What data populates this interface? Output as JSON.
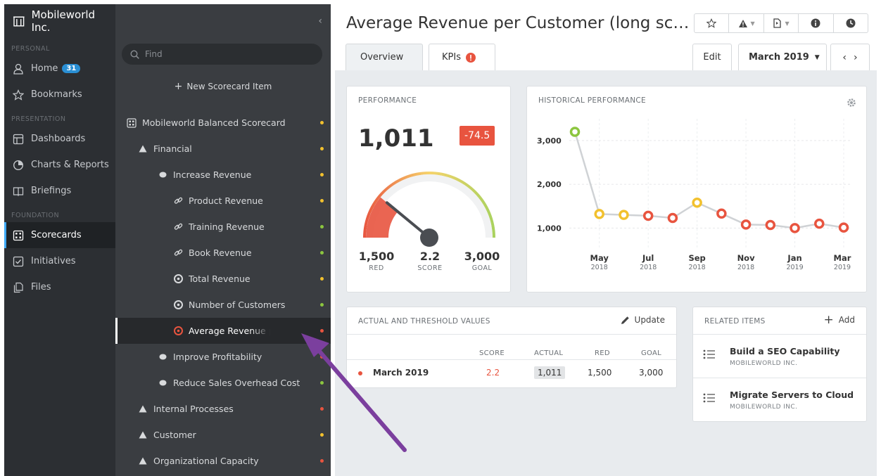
{
  "nav": {
    "brand": "Mobileworld Inc.",
    "sections": {
      "personal": "PERSONAL",
      "presentation": "PRESENTATION",
      "foundation": "FOUNDATION"
    },
    "items": {
      "home": "Home",
      "home_badge": "31",
      "bookmarks": "Bookmarks",
      "dashboards": "Dashboards",
      "charts": "Charts & Reports",
      "briefings": "Briefings",
      "scorecards": "Scorecards",
      "initiatives": "Initiatives",
      "files": "Files"
    }
  },
  "tree": {
    "find_placeholder": "Find",
    "new_item": "New Scorecard Item",
    "rows": [
      {
        "label": "Mobileworld Balanced Scorecard",
        "icon": "scorecard-icon",
        "status": "#f2c12e"
      },
      {
        "label": "Financial",
        "icon": "triangle-icon",
        "status": "#f2c12e"
      },
      {
        "label": "Increase Revenue",
        "icon": "ellipse-icon",
        "status": "#f2c12e"
      },
      {
        "label": "Product Revenue",
        "icon": "link-icon",
        "status": "#f2c12e"
      },
      {
        "label": "Training Revenue",
        "icon": "link-icon",
        "status": "#8cc63f"
      },
      {
        "label": "Book Revenue",
        "icon": "link-icon",
        "status": "#8cc63f"
      },
      {
        "label": "Total Revenue",
        "icon": "kpi-icon",
        "status": "#f2c12e"
      },
      {
        "label": "Number of Customers",
        "icon": "kpi-icon",
        "status": "#8cc63f"
      },
      {
        "label": "Average Revenue per Cu",
        "icon": "kpi-icon",
        "status": "#e8543f"
      },
      {
        "label": "Improve Profitability",
        "icon": "ellipse-icon",
        "status": "#e8543f"
      },
      {
        "label": "Reduce Sales Overhead Cost",
        "icon": "ellipse-icon",
        "status": "#8cc63f"
      },
      {
        "label": "Internal Processes",
        "icon": "triangle-icon",
        "status": "#e8543f"
      },
      {
        "label": "Customer",
        "icon": "triangle-icon",
        "status": "#f2c12e"
      },
      {
        "label": "Organizational Capacity",
        "icon": "triangle-icon",
        "status": "#e8543f"
      }
    ]
  },
  "header": {
    "title": "Average Revenue per Customer (long sc…",
    "tabs": {
      "overview": "Overview",
      "kpis": "KPIs",
      "edit": "Edit"
    },
    "period": "March 2019"
  },
  "performance": {
    "title": "PERFORMANCE",
    "actual": "1,011",
    "delta": "-74.5",
    "red_value": "1,500",
    "red_label": "RED",
    "score_value": "2.2",
    "score_label": "SCORE",
    "goal_value": "3,000",
    "goal_label": "GOAL",
    "gauge_score": 2.2,
    "gauge_max": 10
  },
  "history": {
    "title": "HISTORICAL PERFORMANCE"
  },
  "chart_data": {
    "type": "line",
    "title": "HISTORICAL PERFORMANCE",
    "x": [
      "Apr 2018",
      "May 2018",
      "Jun 2018",
      "Jul 2018",
      "Aug 2018",
      "Sep 2018",
      "Oct 2018",
      "Nov 2018",
      "Dec 2018",
      "Jan 2019",
      "Feb 2019",
      "Mar 2019"
    ],
    "values": [
      3200,
      1320,
      1300,
      1280,
      1230,
      1580,
      1330,
      1080,
      1070,
      1000,
      1100,
      1011
    ],
    "point_status": [
      "#8cc63f",
      "#f2c12e",
      "#f2c12e",
      "#e8543f",
      "#e8543f",
      "#f2c12e",
      "#e8543f",
      "#e8543f",
      "#e8543f",
      "#e8543f",
      "#e8543f",
      "#e8543f"
    ],
    "x_tick_labels": [
      {
        "month": "May",
        "year": "2018"
      },
      {
        "month": "Jul",
        "year": "2018"
      },
      {
        "month": "Sep",
        "year": "2018"
      },
      {
        "month": "Nov",
        "year": "2018"
      },
      {
        "month": "Jan",
        "year": "2019"
      },
      {
        "month": "Mar",
        "year": "2019"
      }
    ],
    "y_ticks": [
      "1,000",
      "2,000",
      "3,000"
    ],
    "ylim": [
      700,
      3400
    ],
    "grid": true
  },
  "thresholds": {
    "title": "ACTUAL AND THRESHOLD VALUES",
    "update": "Update",
    "headers": {
      "score": "SCORE",
      "actual": "ACTUAL",
      "red": "RED",
      "goal": "GOAL"
    },
    "row": {
      "period": "March 2019",
      "score": "2.2",
      "actual": "1,011",
      "red": "1,500",
      "goal": "3,000",
      "status": "#e8543f"
    }
  },
  "related": {
    "title": "RELATED ITEMS",
    "add": "Add",
    "items": [
      {
        "name": "Build a SEO Capability",
        "org": "MOBILEWORLD INC."
      },
      {
        "name": "Migrate Servers to Cloud",
        "org": "MOBILEWORLD INC."
      }
    ]
  },
  "colors": {
    "red": "#e8543f",
    "yellow": "#f2c12e",
    "green": "#8cc63f",
    "accent": "#3fa9f5",
    "annotation_arrow": "#7b3f9e"
  }
}
